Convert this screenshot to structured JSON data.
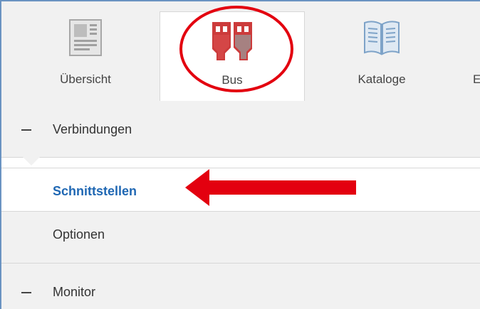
{
  "ribbon": {
    "tabs": [
      {
        "label": "Übersicht",
        "icon": "overview-document-icon",
        "active": false
      },
      {
        "label": "Bus",
        "icon": "bus-connectors-icon",
        "active": true
      },
      {
        "label": "Kataloge",
        "icon": "catalog-book-icon",
        "active": false
      },
      {
        "label": "E",
        "icon": "",
        "active": false
      }
    ]
  },
  "sections": [
    {
      "title": "Verbindungen",
      "expanded": true,
      "items": [
        {
          "label": "Schnittstellen",
          "selected": true
        },
        {
          "label": "Optionen",
          "selected": false
        }
      ]
    },
    {
      "title": "Monitor",
      "expanded": true,
      "items": []
    }
  ],
  "colors": {
    "accent_blue": "#1f67b3",
    "annotation_red": "#e3000f",
    "bus_icon_red": "#cc3b3b",
    "panel_gray": "#f1f1f1",
    "window_border": "#6a93c2"
  }
}
